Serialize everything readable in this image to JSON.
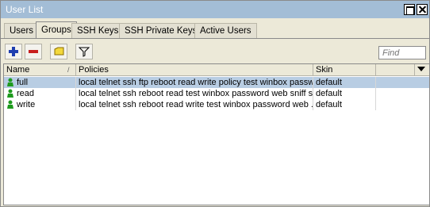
{
  "window": {
    "title": "User List"
  },
  "tabs": [
    {
      "label": "Users"
    },
    {
      "label": "Groups"
    },
    {
      "label": "SSH Keys"
    },
    {
      "label": "SSH Private Keys"
    },
    {
      "label": "Active Users"
    }
  ],
  "active_tab": "Groups",
  "toolbar": {
    "add_icon": "plus-icon",
    "remove_icon": "minus-icon",
    "comment_icon": "note-icon",
    "filter_icon": "filter-icon",
    "find_placeholder": "Find"
  },
  "table": {
    "columns": [
      {
        "label": "Name"
      },
      {
        "label": "Policies"
      },
      {
        "label": "Skin"
      }
    ],
    "rows": [
      {
        "name": "full",
        "policies": "local telnet ssh ftp reboot read write policy test winbox passw...",
        "skin": "default",
        "selected": true
      },
      {
        "name": "read",
        "policies": "local telnet ssh reboot read test winbox password web sniff s...",
        "skin": "default",
        "selected": false
      },
      {
        "name": "write",
        "policies": "local telnet ssh reboot read write test winbox password web ...",
        "skin": "default",
        "selected": false
      }
    ]
  },
  "colors": {
    "titlebar": "#a3bdd6",
    "selected_row": "#b8cde3",
    "user_icon": "#1e9a1e"
  }
}
